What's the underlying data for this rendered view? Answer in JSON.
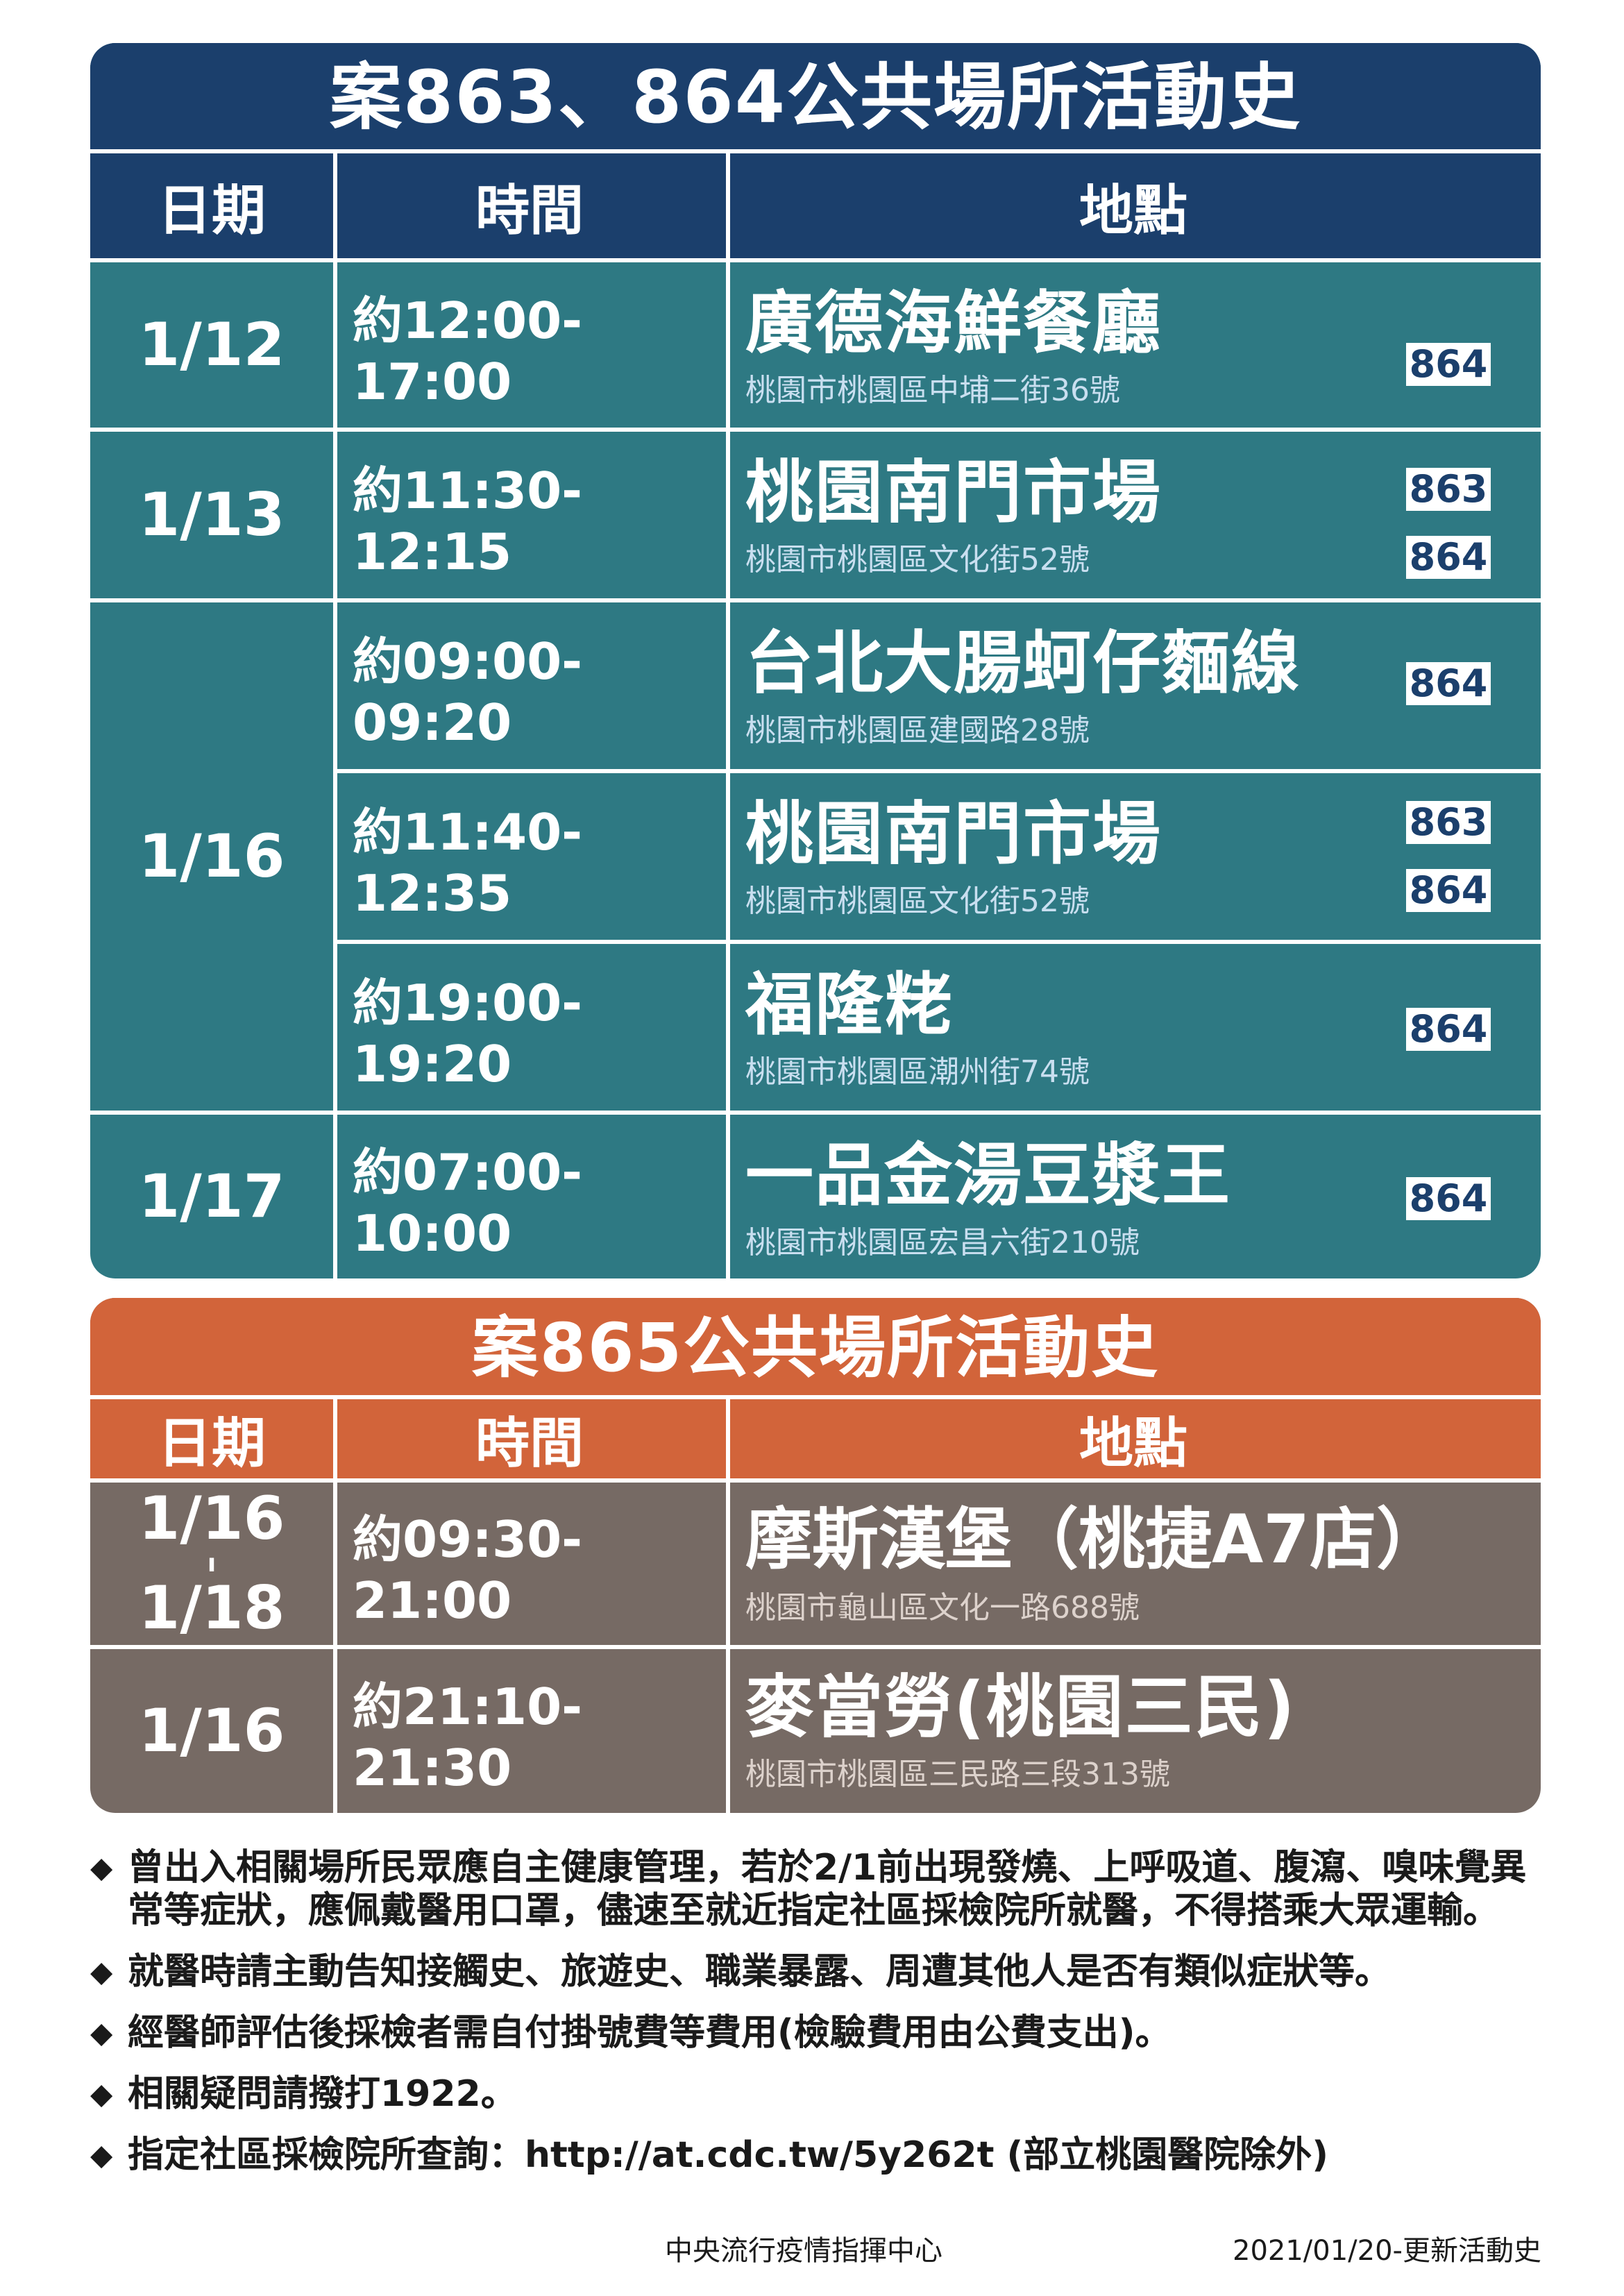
{
  "colors": {
    "blue_header": "#1b3f6c",
    "teal_body": "#2e7983",
    "orange_header": "#d2643a",
    "brown_body": "#766a64",
    "badge_text": "#1b3f6c",
    "address_blue": "#c9dff0",
    "address_brown": "#ddd2cc"
  },
  "section1": {
    "title": "案863、864公共場所活動史",
    "headers": {
      "date": "日期",
      "time": "時間",
      "place": "地點"
    },
    "rows": [
      {
        "date": "1/12",
        "time": "約12:00-17:00",
        "name": "廣德海鮮餐廳",
        "address": "桃園市桃園區中埔二街36號",
        "badges": [
          "864"
        ]
      },
      {
        "date": "1/13",
        "time": "約11:30-12:15",
        "name": "桃園南門市場",
        "address": "桃園市桃園區文化街52號",
        "badges": [
          "863",
          "864"
        ]
      },
      {
        "date": "1/16",
        "time": "約09:00-09:20",
        "name": "台北大腸蚵仔麵線",
        "address": "桃園市桃園區建國路28號",
        "badges": [
          "864"
        ]
      },
      {
        "date": "",
        "time": "約11:40-12:35",
        "name": "桃園南門市場",
        "address": "桃園市桃園區文化街52號",
        "badges": [
          "863",
          "864"
        ]
      },
      {
        "date": "",
        "time": "約19:00-19:20",
        "name": "福隆粩",
        "address": "桃園市桃園區潮州街74號",
        "badges": [
          "864"
        ]
      },
      {
        "date": "1/17",
        "time": "約07:00-10:00",
        "name": "一品金湯豆漿王",
        "address": "桃園市桃園區宏昌六街210號",
        "badges": [
          "864"
        ]
      }
    ]
  },
  "section2": {
    "title": "案865公共場所活動史",
    "headers": {
      "date": "日期",
      "time": "時間",
      "place": "地點"
    },
    "rows": [
      {
        "date_top": "1/16",
        "date_sep": "ı",
        "date_bottom": "1/18",
        "time": "約09:30-21:00",
        "name": "摩斯漢堡（桃捷A7店）",
        "address": "桃園市龜山區文化一路688號"
      },
      {
        "date": "1/16",
        "time": "約21:10-21:30",
        "name": "麥當勞(桃園三民)",
        "address": "桃園市桃園區三民路三段313號"
      }
    ]
  },
  "notes": [
    {
      "bullet": "◆",
      "text": "曾出入相關場所民眾應自主健康管理，若於2/1前出現發燒、上呼吸道、腹瀉、嗅味覺異常等症狀，應佩戴醫用口罩，儘速至就近指定社區採檢院所就醫，不得搭乘大眾運輸。"
    },
    {
      "bullet": "◆",
      "text": "就醫時請主動告知接觸史、旅遊史、職業暴露、周遭其他人是否有類似症狀等。"
    },
    {
      "bullet": "◆",
      "text": "經醫師評估後採檢者需自付掛號費等費用(檢驗費用由公費支出)。"
    },
    {
      "bullet": "◆",
      "text": "相關疑問請撥打1922。"
    },
    {
      "bullet": "◆",
      "text": "指定社區採檢院所查詢：http://at.cdc.tw/5y262t (部立桃園醫院除外)"
    }
  ],
  "footer": {
    "agency": "中央流行疫情指揮中心",
    "updated": "2021/01/20-更新活動史"
  }
}
